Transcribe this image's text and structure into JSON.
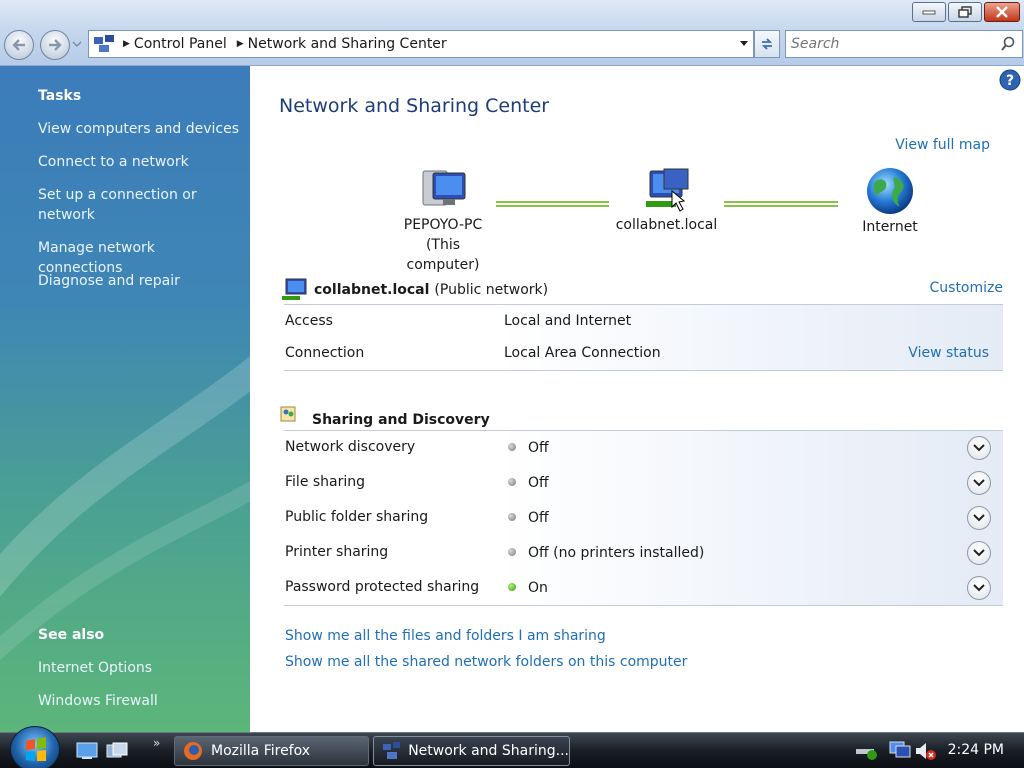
{
  "window": {
    "minimize_icon": "minimize-icon",
    "maximize_icon": "restore-icon",
    "close_icon": "close-icon"
  },
  "addressbar": {
    "crumbs": [
      "Control Panel",
      "Network and Sharing Center"
    ],
    "search_placeholder": "Search"
  },
  "sidebar": {
    "tasks_heading": "Tasks",
    "tasks": [
      "View computers and devices",
      "Connect to a network",
      "Set up a connection or network",
      "Manage network connections",
      "Diagnose and repair"
    ],
    "see_also_heading": "See also",
    "see_also": [
      "Internet Options",
      "Windows Firewall"
    ]
  },
  "main": {
    "title": "Network and Sharing Center",
    "view_full_map": "View full map",
    "map": {
      "computer_name": "PEPOYO-PC",
      "computer_note": "(This computer)",
      "network_name": "collabnet.local",
      "internet": "Internet"
    },
    "network": {
      "name": "collabnet.local",
      "type": "(Public network)",
      "customize": "Customize",
      "rows": [
        {
          "label": "Access",
          "value": "Local and Internet",
          "action": ""
        },
        {
          "label": "Connection",
          "value": "Local Area Connection",
          "action": "View status"
        }
      ]
    },
    "sharing": {
      "heading": "Sharing and Discovery",
      "rows": [
        {
          "label": "Network discovery",
          "status": "Off"
        },
        {
          "label": "File sharing",
          "status": "Off"
        },
        {
          "label": "Public folder sharing",
          "status": "Off"
        },
        {
          "label": "Printer sharing",
          "status": "Off (no printers installed)"
        },
        {
          "label": "Password protected sharing",
          "status": "On"
        }
      ]
    },
    "links": [
      "Show me all the files and folders I am sharing",
      "Show me all the shared network folders on this computer"
    ]
  },
  "taskbar": {
    "tasks": [
      "Mozilla Firefox",
      "Network and Sharing..."
    ],
    "clock": "2:24 PM"
  },
  "colors": {
    "link": "#1f6fb5",
    "title": "#1e3d78",
    "status_on": "#2f9a12",
    "status_off": "#7a7a7a"
  }
}
